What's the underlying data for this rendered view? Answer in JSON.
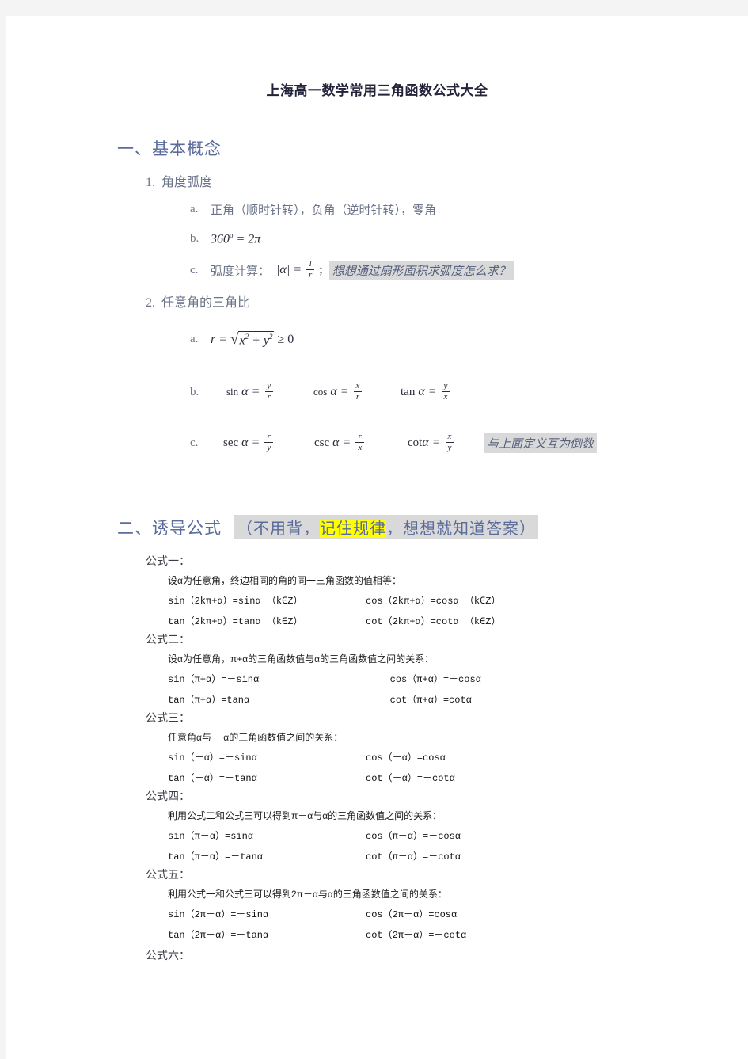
{
  "document": {
    "title": "上海高一数学常用三角函数公式大全"
  },
  "section1": {
    "heading": "一、基本概念",
    "items": [
      {
        "num": "1.",
        "label": "角度弧度",
        "subitems": [
          {
            "letter": "a.",
            "text": "正角（顺时针转），负角（逆时针转），零角"
          },
          {
            "letter": "b.",
            "formula": "360° = 2π"
          },
          {
            "letter": "c.",
            "text": "弧度计算：",
            "formula": "|α| = l / r ;",
            "annotation": "想想通过扇形面积求弧度怎么求？"
          }
        ]
      },
      {
        "num": "2.",
        "label": "任意角的三角比",
        "subitems": [
          {
            "letter": "a.",
            "formula": "r = √(x² + y²) ≥ 0"
          },
          {
            "letter": "b.",
            "f1": "sin α = y/r",
            "f2": "cos α = x/r",
            "f3": "tan α = y/x"
          },
          {
            "letter": "c.",
            "f1": "sec α = r/y",
            "f2": "csc α = r/x",
            "f3": "cot α = x/y",
            "annotation": "与上面定义互为倒数"
          }
        ]
      }
    ]
  },
  "section2": {
    "heading": "二、诱导公式",
    "note_prefix": "（不用背，",
    "note_highlight": "记住规律",
    "note_suffix": "，想想就知道答案）",
    "formulas": [
      {
        "label": "公式一：",
        "desc": "设α为任意角，终边相同的角的同一三角函数的值相等：",
        "rows": [
          {
            "left": "sin（2kπ+α）=sinα （k∈Z）",
            "right": "cos（2kπ+α）=cosα （k∈Z）"
          },
          {
            "left": "tan（2kπ+α）=tanα （k∈Z）",
            "right": "cot（2kπ+α）=cotα （k∈Z）"
          }
        ]
      },
      {
        "label": "公式二：",
        "desc": "设α为任意角，π+α的三角函数值与α的三角函数值之间的关系：",
        "rows": [
          {
            "left": "sin（π+α）=－sinα",
            "right": "cos（π+α）=－cosα"
          },
          {
            "left": "tan（π+α）=tanα",
            "right": "cot（π+α）=cotα"
          }
        ]
      },
      {
        "label": "公式三：",
        "desc": "任意角α与 －α的三角函数值之间的关系：",
        "rows": [
          {
            "left": "sin（－α）=－sinα",
            "right": "cos（－α）=cosα"
          },
          {
            "left": "tan（－α）=－tanα",
            "right": "cot（－α）=－cotα"
          }
        ]
      },
      {
        "label": "公式四：",
        "desc": "利用公式二和公式三可以得到π－α与α的三角函数值之间的关系：",
        "rows": [
          {
            "left": "sin（π－α）=sinα",
            "right": "cos（π－α）=－cosα"
          },
          {
            "left": "tan（π－α）=－tanα",
            "right": "cot（π－α）=－cotα"
          }
        ]
      },
      {
        "label": "公式五：",
        "desc": "利用公式一和公式三可以得到2π－α与α的三角函数值之间的关系：",
        "rows": [
          {
            "left": "sin（2π－α）=－sinα",
            "right": "cos（2π－α）=cosα"
          },
          {
            "left": "tan（2π－α）=－tanα",
            "right": "cot（2π－α）=－cotα"
          }
        ]
      },
      {
        "label": "公式六：",
        "desc": "",
        "rows": []
      }
    ]
  }
}
